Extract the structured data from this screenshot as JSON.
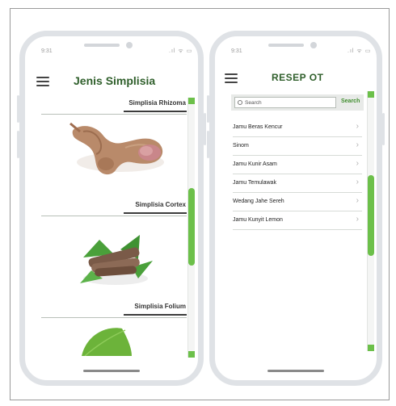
{
  "left_phone": {
    "status_time": "9:31",
    "status_icons": ".ıl ᯤ ▭",
    "title": "Jenis Simplisia",
    "sections": [
      {
        "label": "Simplisia Rhizoma",
        "image": "rhizome-image"
      },
      {
        "label": "Simplisia Cortex",
        "image": "bark-image"
      },
      {
        "label": "Simplisia Folium",
        "image": "leaf-image"
      }
    ]
  },
  "right_phone": {
    "status_time": "9:31",
    "status_icons": ".ıl ᯤ ▭",
    "title": "RESEP OT",
    "search": {
      "placeholder": "Search",
      "button_label": "Search"
    },
    "items": [
      "Jamu Beras Kencur",
      "Sinom",
      "Jamu Kunir Asam",
      "Jamu Temulawak",
      "Wedang Jahe Sereh",
      "Jamu Kunyit Lemon"
    ]
  },
  "colors": {
    "accent_green": "#6cc04a",
    "title_green": "#2f5f2b",
    "phone_frame": "#dfe2e6"
  },
  "icons": [
    "hamburger-menu-icon",
    "search-icon",
    "chevron-right-icon",
    "scroll-up-arrow-icon",
    "scroll-down-arrow-icon"
  ]
}
